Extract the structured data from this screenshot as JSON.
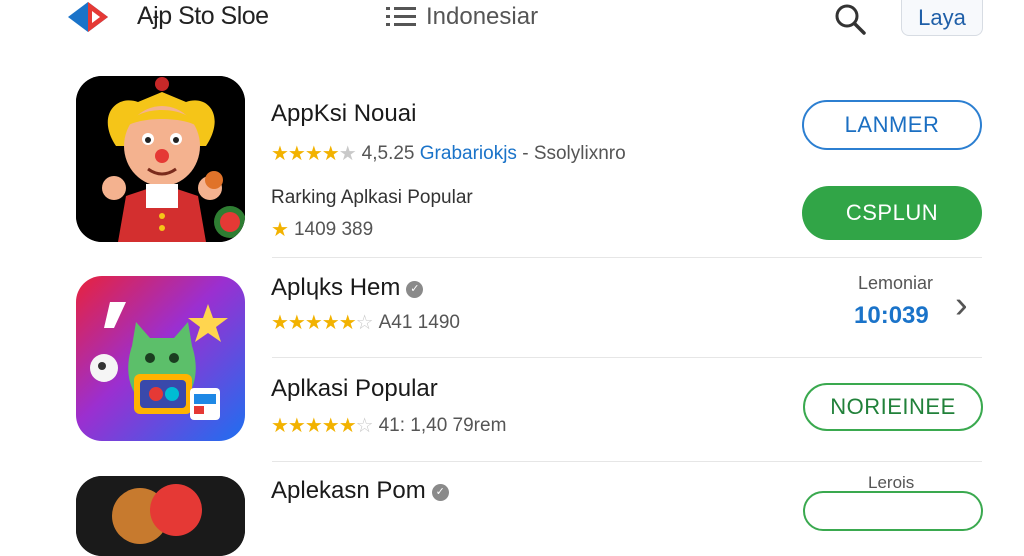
{
  "header": {
    "title": "Aɉp Sto Sloe",
    "region": "Indonesiar",
    "lang_button": "Laya"
  },
  "rows": [
    {
      "name": "AppKsi Nouai",
      "rating": "4,5.25",
      "developer": "Grabariokjs",
      "separator": "-",
      "category": "Ssolylixnro",
      "subtitle": "Rarking Aplkasi Popular",
      "count": "1409 389",
      "primary_button": "LANMER",
      "secondary_button": "CSPLUN"
    },
    {
      "name": "Aplɥks Hem",
      "rating": "A41 1490",
      "side_label": "Lemoniar",
      "side_value": "10:039",
      "chevron": "›"
    },
    {
      "name": "Aplkasi Popular",
      "rating": "41: 1,40 79rem",
      "button": "NORIEINEE"
    },
    {
      "name": "Aplekasn Pom",
      "side_label": "Lerois"
    }
  ],
  "colors": {
    "accent_blue": "#1a73c9",
    "accent_green": "#31a547",
    "star": "#f2b200"
  },
  "icons": [
    "logo-icon",
    "menu-icon",
    "search-icon",
    "star-icon",
    "verified-icon",
    "chevron-right-icon"
  ]
}
